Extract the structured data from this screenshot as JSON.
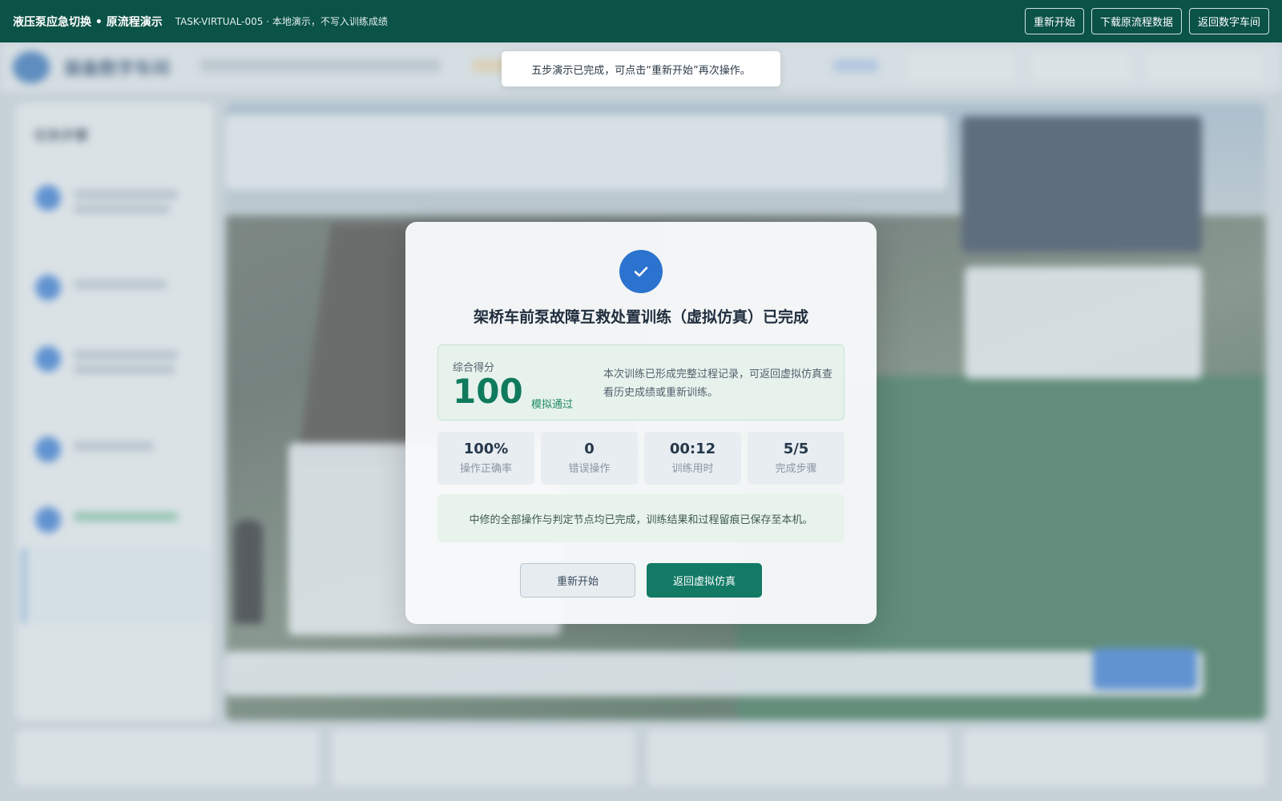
{
  "topbar": {
    "title": "液压泵应急切换 • 原流程演示",
    "subtitle": "TASK-VIRTUAL-005 · 本地演示，不写入训练成绩",
    "restart": "重新开始",
    "download": "下载原流程数据",
    "back": "返回数字车间"
  },
  "toast": {
    "message": "五步演示已完成，可点击“重新开始”再次操作。"
  },
  "background": {
    "logo_text": "装备数字车间",
    "sidebar_title": "任务步骤"
  },
  "modal": {
    "check_icon": "check-icon",
    "title": "架桥车前泵故障互救处置训练（虚拟仿真）已完成",
    "score_label": "综合得分",
    "score_value": "100",
    "score_status": "模拟通过",
    "score_desc": "本次训练已形成完整过程记录，可返回虚拟仿真查看历史成绩或重新训练。",
    "stats": [
      {
        "value": "100%",
        "label": "操作正确率"
      },
      {
        "value": "0",
        "label": "错误操作"
      },
      {
        "value": "00:12",
        "label": "训练用时"
      },
      {
        "value": "5/5",
        "label": "完成步骤"
      }
    ],
    "note": "中修的全部操作与判定节点均已完成，训练结果和过程留痕已保存至本机。",
    "restart_button": "重新开始",
    "return_button": "返回虚拟仿真"
  },
  "colors": {
    "topbar": "#0b5247",
    "primary": "#137a66",
    "accent_blue": "#2b73cf",
    "score": "#107a5e"
  }
}
